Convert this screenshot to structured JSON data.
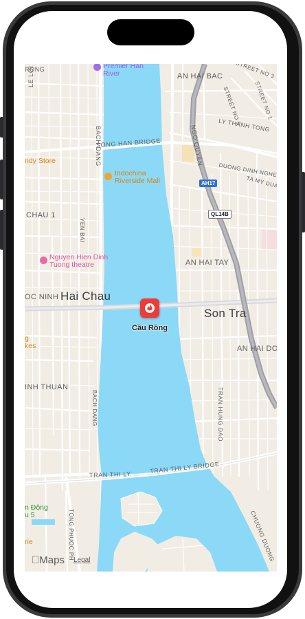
{
  "map": {
    "streets": {
      "rong": "RONG",
      "le_loi": "LE LOI",
      "bach_dang_top": "BACH DANG",
      "bach_dang_bottom": "BACH DANG",
      "song_han_bridge": "SONG HAN BRIDGE",
      "yen_bai": "YEN BAI",
      "an_hai_bac": "AN HAI BAC",
      "street_no_3": "STREET NO 3",
      "street_no_5": "STREET NO 5",
      "street_no_1": "STREET NO 1",
      "ly_thanh_tong": "LY THANH TONG",
      "ngo_quyen": "NGO QUYEN",
      "duong_dinh_nghe": "DUONG DINH NGHE",
      "ta_my_duat": "TA MY DUAT",
      "chau_1": "CHAU 1",
      "an_hai_tay": "AN HAI TAY",
      "oc_ninh": "OC NINH",
      "an_hai_do": "AN HAI DO",
      "inh_thuan": "INH THUAN",
      "tran_hung_dao": "TRAN HUNG DAO",
      "tran_thi_ly": "TRAN THI LY",
      "tran_thi_ly_bridge": "TRAN THI LY BRIDGE",
      "tong_phuoc_phu": "TONG PHUOC PH",
      "chuong_duong": "CHUONG DUONG"
    },
    "cities": {
      "hai_chau": "Hai Chau",
      "son_tra": "Son Tra"
    },
    "pois": {
      "premier_han_line1": "Premier Han",
      "premier_han_line2": "River",
      "candy_store": "ndy Store",
      "indochina_line1": "Indochina",
      "indochina_line2": "Riverside Mall",
      "nguyen_line1": "Nguyen Hien Dinh",
      "nguyen_line2": "Tuong theatre",
      "orange_partial_line1": "g",
      "orange_partial_line2": "kes",
      "green_line1": "n Động",
      "green_line2": "u 5",
      "orange_bottom": "rie"
    },
    "shields": {
      "ah17": "AH17",
      "ql14b": "QL14B"
    },
    "selected_pin": {
      "label": "Cầu Rồng",
      "color": "#ef3b37"
    },
    "attribution": {
      "logo_text": "Maps",
      "legal": "Legal"
    },
    "colors": {
      "water": "#8bd9f7",
      "land": "#f1ede4",
      "highway": "#a9a9ae",
      "road": "#ffffff"
    }
  }
}
